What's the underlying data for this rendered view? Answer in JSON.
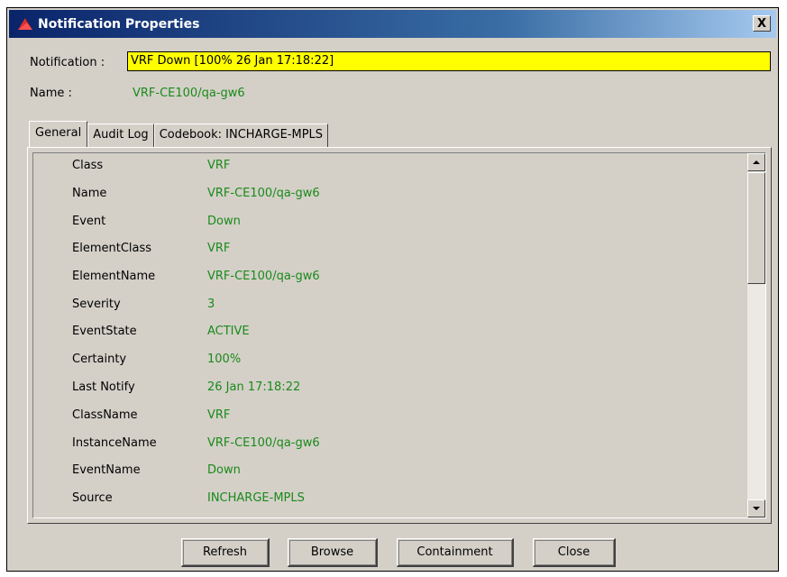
{
  "window": {
    "title": "Notification Properties",
    "close_glyph": "X",
    "icon": "app-logo-icon",
    "accent_color": "#0a246a"
  },
  "header": {
    "notification_label": "Notification :",
    "notification_value": "VRF Down  [100% 26 Jan 17:18:22]",
    "notification_highlight_color": "#ffff00",
    "name_label": "Name :",
    "name_value": "VRF-CE100/qa-gw6"
  },
  "tabs": [
    {
      "label": "General",
      "active": true
    },
    {
      "label": "Audit Log",
      "active": false
    },
    {
      "label": "Codebook: INCHARGE-MPLS",
      "active": false
    }
  ],
  "properties": [
    {
      "key": "Class",
      "value": "VRF"
    },
    {
      "key": "Name",
      "value": "VRF-CE100/qa-gw6"
    },
    {
      "key": "Event",
      "value": "Down"
    },
    {
      "key": "ElementClass",
      "value": "VRF"
    },
    {
      "key": "ElementName",
      "value": "VRF-CE100/qa-gw6"
    },
    {
      "key": "Severity",
      "value": "3"
    },
    {
      "key": "EventState",
      "value": "ACTIVE"
    },
    {
      "key": "Certainty",
      "value": "100%"
    },
    {
      "key": "Last Notify",
      "value": "26 Jan 17:18:22"
    },
    {
      "key": "ClassName",
      "value": "VRF"
    },
    {
      "key": "InstanceName",
      "value": "VRF-CE100/qa-gw6"
    },
    {
      "key": "EventName",
      "value": "Down"
    },
    {
      "key": "Source",
      "value": "INCHARGE-MPLS"
    }
  ],
  "value_color": "#1a8a1a",
  "buttons": {
    "refresh": "Refresh",
    "browse": "Browse",
    "containment": "Containment",
    "close": "Close"
  }
}
